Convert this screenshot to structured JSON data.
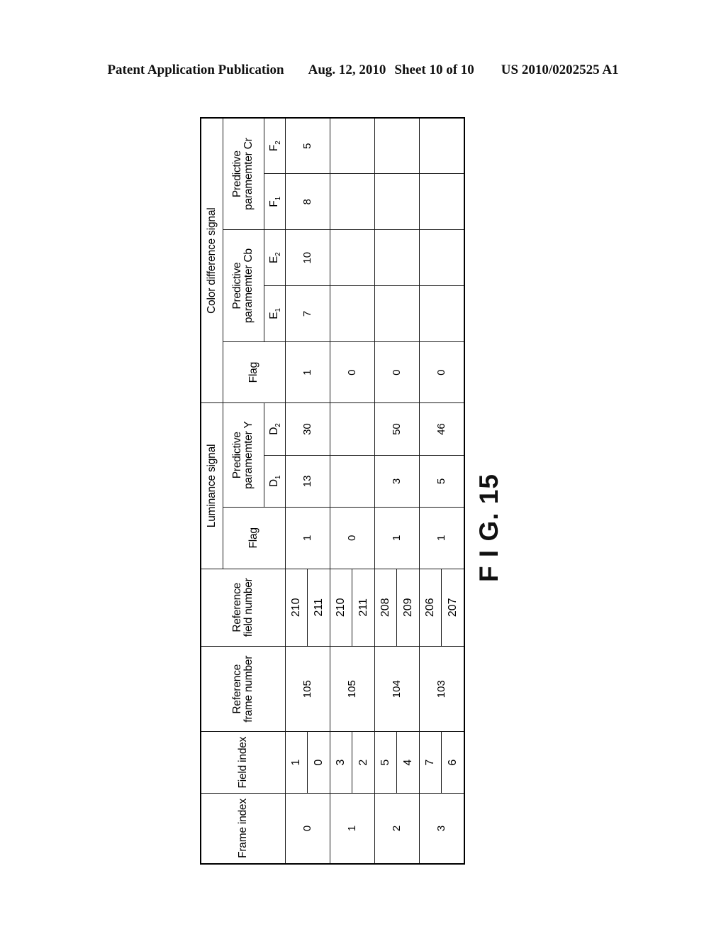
{
  "page": {
    "publication_label": "Patent Application Publication",
    "date": "Aug. 12, 2010",
    "sheet": "Sheet 10 of 10",
    "doc_number": "US 2010/0202525 A1"
  },
  "figure": {
    "label": "F I G. 15"
  },
  "table": {
    "group_headers": {
      "frame_index": "Frame index",
      "field_index": "Field index",
      "reference_frame_number_line1": "Reference",
      "reference_frame_number_line2": "frame number",
      "reference_field_number_line1": "Reference",
      "reference_field_number_line2": "field number",
      "luminance_signal": "Luminance signal",
      "color_difference_signal": "Color difference signal"
    },
    "sub_headers": {
      "luma_flag": "Flag",
      "predictive_parameter_y_line1": "Predictive",
      "predictive_parameter_y_line2": "paramemter Y",
      "d1": "D",
      "d1_sub": "1",
      "d2": "D",
      "d2_sub": "2",
      "chroma_flag": "Flag",
      "predictive_parameter_cb_line1": "Predictive",
      "predictive_parameter_cb_line2": "paramemter Cb",
      "e1": "E",
      "e1_sub": "1",
      "e2": "E",
      "e2_sub": "2",
      "predictive_parameter_cr_line1": "Predictive",
      "predictive_parameter_cr_line2": "paramemter Cr",
      "f1": "F",
      "f1_sub": "1",
      "f2": "F",
      "f2_sub": "2"
    },
    "rows": [
      {
        "frame_index": "0",
        "field_index_top": "1",
        "field_index_bottom": "0",
        "reference_frame_number": "105",
        "reference_field_number_top": "210",
        "reference_field_number_bottom": "211",
        "luma_flag": "1",
        "d1": "13",
        "d2": "30",
        "chroma_flag": "1",
        "e1": "7",
        "e2": "10",
        "f1": "8",
        "f2": "5"
      },
      {
        "frame_index": "1",
        "field_index_top": "3",
        "field_index_bottom": "2",
        "reference_frame_number": "105",
        "reference_field_number_top": "210",
        "reference_field_number_bottom": "211",
        "luma_flag": "0",
        "d1": "",
        "d2": "",
        "chroma_flag": "0",
        "e1": "",
        "e2": "",
        "f1": "",
        "f2": ""
      },
      {
        "frame_index": "2",
        "field_index_top": "5",
        "field_index_bottom": "4",
        "reference_frame_number": "104",
        "reference_field_number_top": "208",
        "reference_field_number_bottom": "209",
        "luma_flag": "1",
        "d1": "3",
        "d2": "50",
        "chroma_flag": "0",
        "e1": "",
        "e2": "",
        "f1": "",
        "f2": ""
      },
      {
        "frame_index": "3",
        "field_index_top": "7",
        "field_index_bottom": "6",
        "reference_frame_number": "103",
        "reference_field_number_top": "206",
        "reference_field_number_bottom": "207",
        "luma_flag": "1",
        "d1": "5",
        "d2": "46",
        "chroma_flag": "0",
        "e1": "",
        "e2": "",
        "f1": "",
        "f2": ""
      }
    ]
  }
}
